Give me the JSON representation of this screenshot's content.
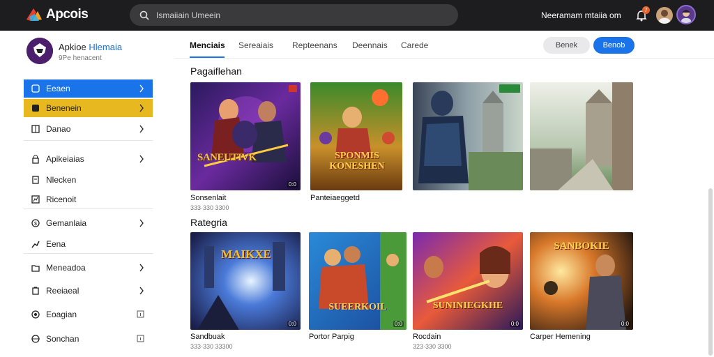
{
  "app": {
    "name": "Apcois"
  },
  "search": {
    "placeholder": "Ismaiiain Umeein"
  },
  "account": {
    "label": "Neeramam mtaiia om",
    "notifications": "7"
  },
  "profile": {
    "name_main": "Apkioe ",
    "name_accent": "Hlemaia",
    "subtitle": "9Pe henacent"
  },
  "sidebar": {
    "items": [
      {
        "label": "Eeaen",
        "icon": "app-icon",
        "chevron": true
      },
      {
        "label": "Benenein",
        "icon": "star-icon",
        "chevron": true
      },
      {
        "label": "Danao",
        "icon": "book-icon",
        "chevron": true
      },
      {
        "label": "Apikeiaias",
        "icon": "lock-icon",
        "chevron": true
      },
      {
        "label": "Nlecken",
        "icon": "document-icon",
        "chevron": false
      },
      {
        "label": "Ricenoit",
        "icon": "chart-icon",
        "chevron": false
      },
      {
        "label": "Gemanlaia",
        "icon": "dollar-icon",
        "chevron": true
      },
      {
        "label": "Eena",
        "icon": "growth-icon",
        "chevron": false
      },
      {
        "label": "Meneadoa",
        "icon": "folder-icon",
        "chevron": true
      },
      {
        "label": "Reeiaeal",
        "icon": "clipboard-icon",
        "chevron": true
      },
      {
        "label": "Eoagian",
        "icon": "settings-icon",
        "chevron": false,
        "trailing_icon": "info-icon"
      },
      {
        "label": "Sonchan",
        "icon": "globe-icon",
        "chevron": false,
        "trailing_icon": "info-icon"
      }
    ]
  },
  "tabs": [
    {
      "label": "Menciais"
    },
    {
      "label": "Sereaiais"
    },
    {
      "label": "Repteenans"
    },
    {
      "label": "Deennais"
    },
    {
      "label": "Carede"
    }
  ],
  "actions": {
    "cancel": "Benek",
    "save": "Benob"
  },
  "sections": [
    {
      "title": "Pagaiflehan",
      "cards": [
        {
          "title": "Sonsenlait",
          "meta": "333·330 3300",
          "art_text": "SANEUTIVK",
          "badge": "0:0"
        },
        {
          "title": "Panteiaeggetd",
          "meta": "",
          "art_text": "SPONMIS KONESHEN",
          "badge": ""
        },
        {
          "title": "",
          "meta": "",
          "art_text": "",
          "badge": ""
        },
        {
          "title": "",
          "meta": "",
          "art_text": "",
          "badge": ""
        }
      ]
    },
    {
      "title": "Rategria",
      "cards": [
        {
          "title": "Sandbuak",
          "meta": "333·330 33300",
          "art_text": "MAIKXE",
          "badge": "0:0"
        },
        {
          "title": "Portor Parpig",
          "meta": "",
          "art_text": "SUEERKOIL",
          "badge": "0:0"
        },
        {
          "title": "Rocdain",
          "meta": "323·330 3300",
          "art_text": "SUNINIEGKHE",
          "badge": "0:0"
        },
        {
          "title": "Carper Hemening",
          "meta": "",
          "art_text": "SANBOKIE",
          "badge": "0:0"
        }
      ]
    }
  ],
  "colors": {
    "topbar": "#1d1d1f",
    "accent": "#1a73e8",
    "highlight": "#e8b820"
  }
}
